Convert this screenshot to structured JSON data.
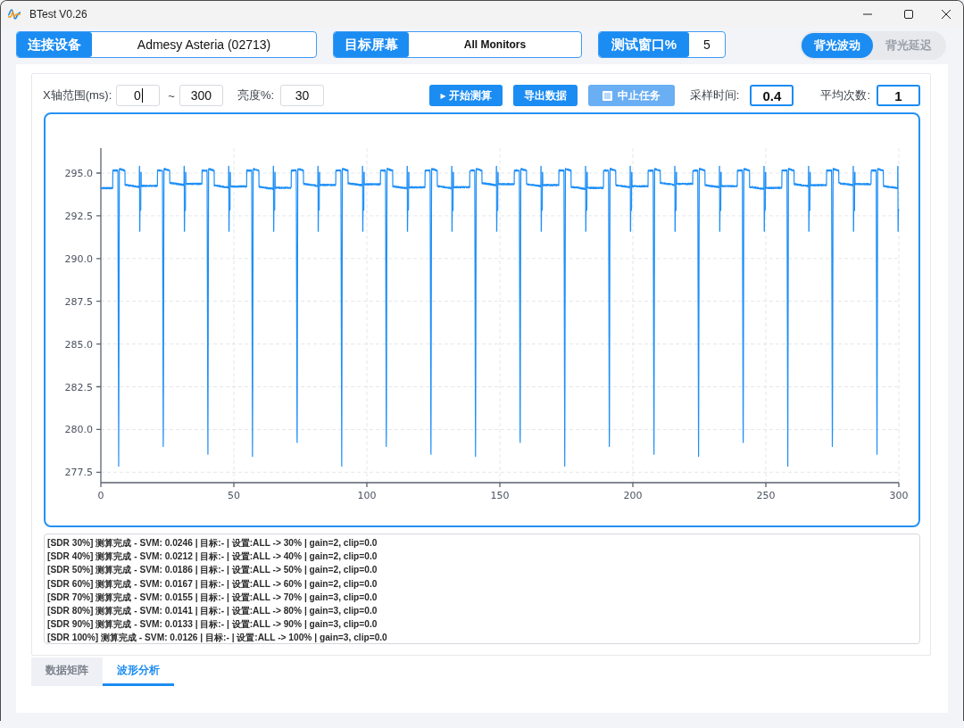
{
  "window": {
    "title": "BTest V0.26"
  },
  "header": {
    "device": {
      "label": "连接设备",
      "value": "Admesy Asteria (02713)"
    },
    "target_screen": {
      "label": "目标屏幕",
      "value": "All Monitors"
    },
    "test_window": {
      "label": "测试窗口%",
      "value": "5"
    },
    "mode_tabs": [
      {
        "label": "背光波动",
        "selected": true
      },
      {
        "label": "背光延迟",
        "selected": false
      }
    ]
  },
  "controls": {
    "x_range": {
      "label": "X轴范围(ms):",
      "from": {
        "value": "0",
        "focused": true
      },
      "separator": "~",
      "to": {
        "value": "300",
        "focused": false
      }
    },
    "brightness": {
      "label": "亮度%:",
      "value": "30"
    },
    "buttons": [
      {
        "label": "▸ 开始测算",
        "kind": "plain",
        "disabled": false
      },
      {
        "label": "导出数据",
        "kind": "plain",
        "disabled": false
      },
      {
        "label": "中止任务",
        "kind": "stop",
        "disabled": true
      }
    ],
    "sample_time": {
      "label": "采样时间:",
      "value": "0.4"
    },
    "average_count": {
      "label": "平均次数:",
      "value": "1"
    }
  },
  "waveform": {
    "y_tick_labels": [
      "295.0",
      "292.5",
      "290.0",
      "287.5",
      "285.0",
      "282.5",
      "280.0",
      "277.5"
    ],
    "x_tick_labels": [
      "0",
      "50",
      "100",
      "150",
      "200",
      "250",
      "300"
    ]
  },
  "log": [
    "[SDR 30%] 测算完成 - SVM: 0.0246 | 目标:- | 设置:ALL -> 30% | gain=2, clip=0.0",
    "[SDR 40%] 测算完成 - SVM: 0.0212 | 目标:- | 设置:ALL -> 40% | gain=2, clip=0.0",
    "[SDR 50%] 测算完成 - SVM: 0.0186 | 目标:- | 设置:ALL -> 50% | gain=2, clip=0.0",
    "[SDR 60%] 测算完成 - SVM: 0.0167 | 目标:- | 设置:ALL -> 60% | gain=2, clip=0.0",
    "[SDR 70%] 测算完成 - SVM: 0.0155 | 目标:- | 设置:ALL -> 70% | gain=3, clip=0.0",
    "[SDR 80%] 测算完成 - SVM: 0.0141 | 目标:- | 设置:ALL -> 80% | gain=3, clip=0.0",
    "[SDR 90%] 测算完成 - SVM: 0.0133 | 目标:- | 设置:ALL -> 90% | gain=3, clip=0.0",
    "[SDR 100%] 测算完成 - SVM: 0.0126 | 目标:- | 设置:ALL -> 100% | gain=3, clip=0.0"
  ],
  "tabs": [
    {
      "label": "数据矩阵",
      "selected": false
    },
    {
      "label": "波形分析",
      "selected": true
    }
  ]
}
